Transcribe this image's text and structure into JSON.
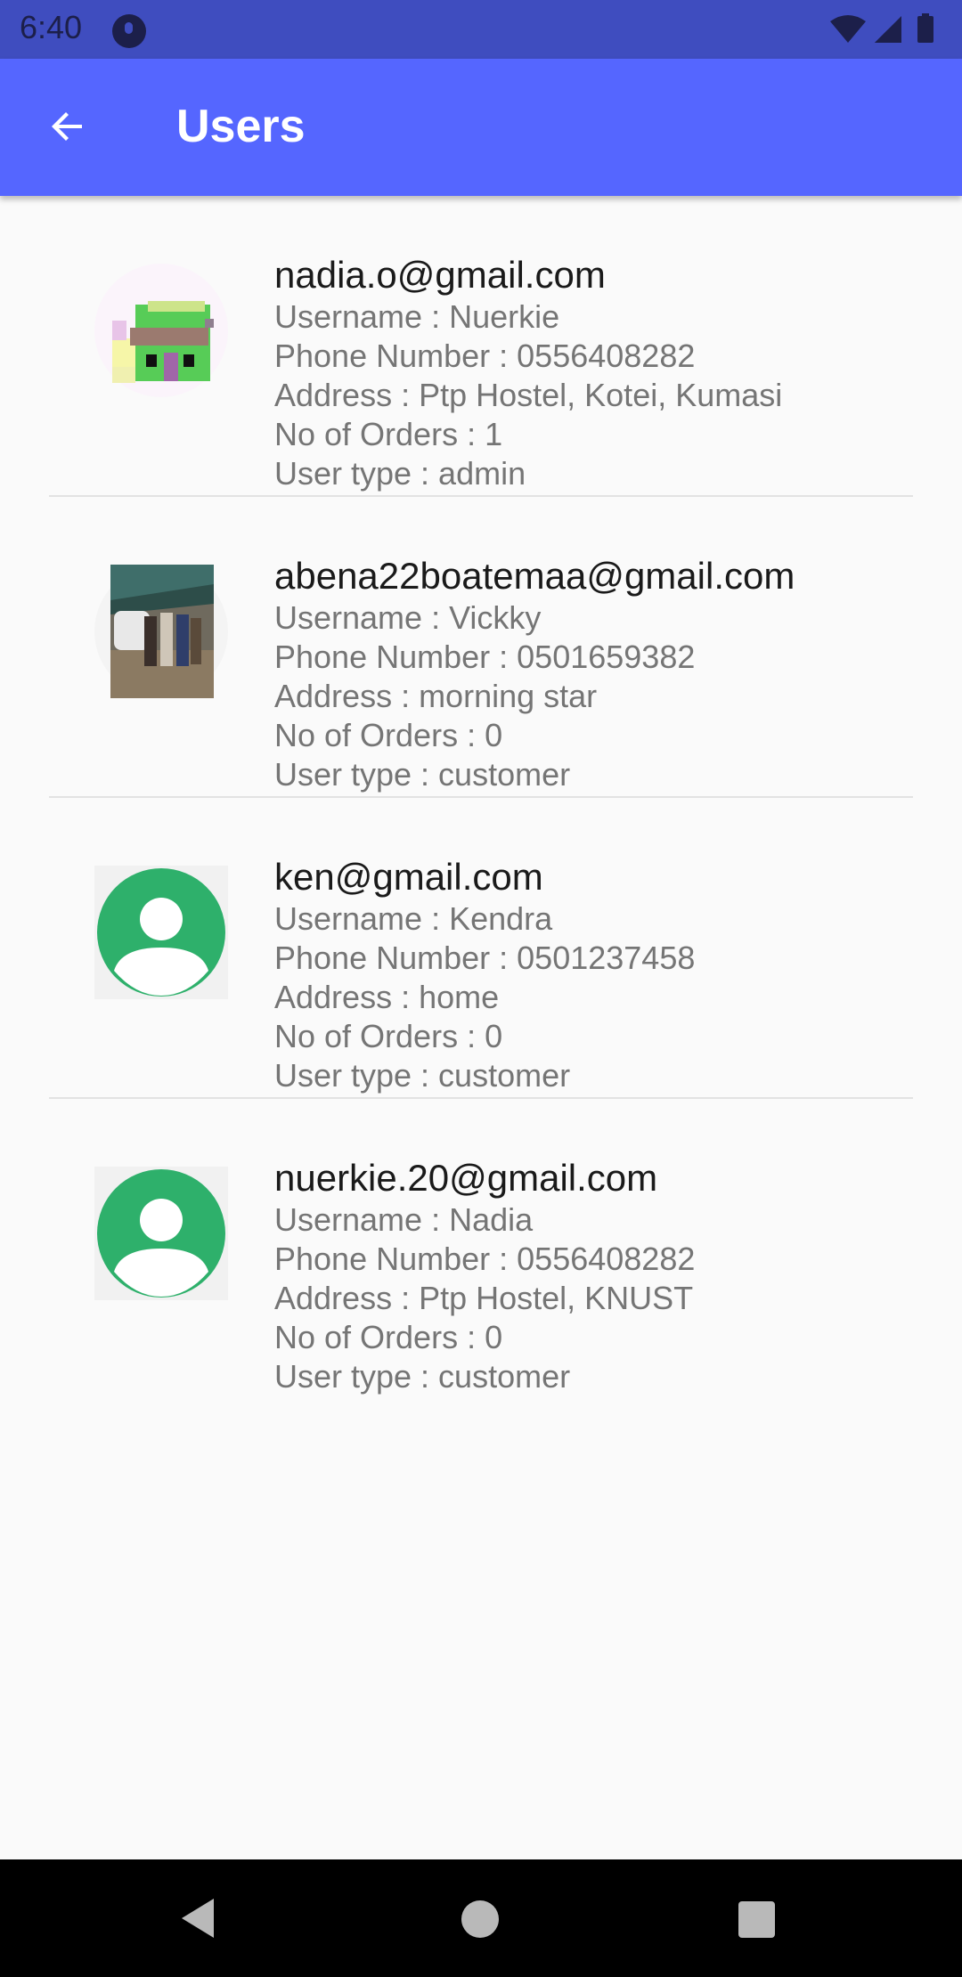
{
  "status_bar": {
    "time": "6:40",
    "icons": [
      "app-notification-icon",
      "wifi-icon",
      "signal-icon",
      "battery-icon"
    ]
  },
  "app_bar": {
    "title": "Users",
    "back_icon": "arrow-back-icon",
    "color": "#5566ff"
  },
  "users": [
    {
      "email": "nadia.o@gmail.com",
      "username": "Username : Nuerkie",
      "phone": "Phone Number : 0556408282",
      "address": "Address : Ptp Hostel, Kotei, Kumasi",
      "orders": "No of Orders : 1",
      "user_type": "User type : admin",
      "avatar": "pixel-photo"
    },
    {
      "email": "abena22boatemaa@gmail.com",
      "username": "Username : Vickky",
      "phone": "Phone Number : 0501659382",
      "address": "Address : morning star",
      "orders": "No of Orders : 0",
      "user_type": "User type : customer",
      "avatar": "group-photo"
    },
    {
      "email": "ken@gmail.com",
      "username": "Username : Kendra",
      "phone": "Phone Number : 0501237458",
      "address": "Address : home",
      "orders": "No of Orders : 0",
      "user_type": "User type : customer",
      "avatar": "default-person-icon"
    },
    {
      "email": "nuerkie.20@gmail.com",
      "username": "Username : Nadia",
      "phone": "Phone Number : 0556408282",
      "address": "Address : Ptp Hostel, KNUST",
      "orders": "No of Orders : 0",
      "user_type": "User type : customer",
      "avatar": "default-person-icon"
    }
  ],
  "nav_bar": {
    "icons": [
      "nav-back-icon",
      "nav-home-icon",
      "nav-recents-icon"
    ]
  }
}
